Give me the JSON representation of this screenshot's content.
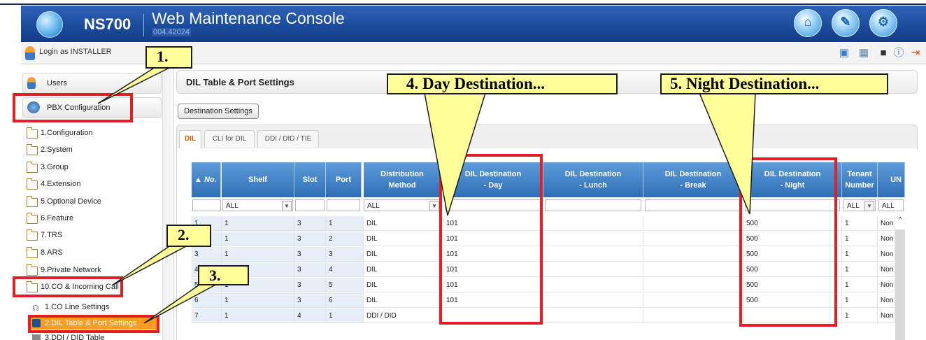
{
  "header": {
    "brand": "NS700",
    "title": "Web Maintenance Console",
    "version": "004.42024",
    "icons": [
      "home-icon",
      "tool-icon",
      "settings-icon"
    ]
  },
  "loginbar": {
    "text": "Login as INSTALLER",
    "tools": [
      "info-icon",
      "save-icon",
      "help-icon",
      "logout-icon"
    ]
  },
  "sidebar": {
    "users": "Users",
    "pbx": "PBX Configuration",
    "items": [
      "1.Configuration",
      "2.System",
      "3.Group",
      "4.Extension",
      "5.Optional Device",
      "6.Feature",
      "7.TRS",
      "8.ARS",
      "9.Private Network",
      "10.CO & Incoming Call"
    ],
    "subitems": [
      "1.CO Line Settings",
      "2.DIL Table & Port Settings",
      "3.DDI / DID Table"
    ]
  },
  "main": {
    "panel_title": "DIL Table & Port Settings",
    "dest_button": "Destination Settings",
    "tabs": [
      "DIL",
      "CLI for DIL",
      "DDI / DID / TIE"
    ]
  },
  "table": {
    "headers": {
      "no": "▲ No.",
      "shelf": "Shelf",
      "slot": "Slot",
      "port": "Port",
      "dist1": "Distribution",
      "dist2": "Method",
      "day1": "DIL Destination",
      "day2": "- Day",
      "lunch1": "DIL Destination",
      "lunch2": "- Lunch",
      "break1": "DIL Destination",
      "break2": "- Break",
      "night1": "DIL Destination",
      "night2": "- Night",
      "tenant1": "Tenant",
      "tenant2": "Number",
      "un": "UN"
    },
    "filters": {
      "shelf": "ALL",
      "dist": "ALL",
      "tenant": "ALL",
      "un": "ALL"
    },
    "rows": [
      {
        "no": "1",
        "shelf": "1",
        "slot": "3",
        "port": "1",
        "dist": "DIL",
        "day": "101",
        "night": "500",
        "tenant": "1",
        "un": "Non"
      },
      {
        "no": "2",
        "shelf": "1",
        "slot": "3",
        "port": "2",
        "dist": "DIL",
        "day": "101",
        "night": "500",
        "tenant": "1",
        "un": "Non"
      },
      {
        "no": "3",
        "shelf": "1",
        "slot": "3",
        "port": "3",
        "dist": "DIL",
        "day": "101",
        "night": "500",
        "tenant": "1",
        "un": "Non"
      },
      {
        "no": "4",
        "shelf": "1",
        "slot": "3",
        "port": "4",
        "dist": "DIL",
        "day": "101",
        "night": "500",
        "tenant": "1",
        "un": "Non"
      },
      {
        "no": "5",
        "shelf": "1",
        "slot": "3",
        "port": "5",
        "dist": "DIL",
        "day": "101",
        "night": "500",
        "tenant": "1",
        "un": "Non"
      },
      {
        "no": "6",
        "shelf": "1",
        "slot": "3",
        "port": "6",
        "dist": "DIL",
        "day": "101",
        "night": "500",
        "tenant": "1",
        "un": "Non"
      },
      {
        "no": "7",
        "shelf": "1",
        "slot": "4",
        "port": "1",
        "dist": "DDI / DID",
        "day": "",
        "night": "",
        "tenant": "1",
        "un": "Non"
      }
    ]
  },
  "callouts": {
    "c1": "1.",
    "c2": "2.",
    "c3": "3.",
    "c4": "4. Day Destination...",
    "c5": "5. Night Destination..."
  },
  "colors": {
    "header_blue": "#1a4a9a",
    "highlight_red": "#e41e25",
    "callout_yellow": "#ffff99",
    "selected_orange": "#ff9b1e"
  }
}
